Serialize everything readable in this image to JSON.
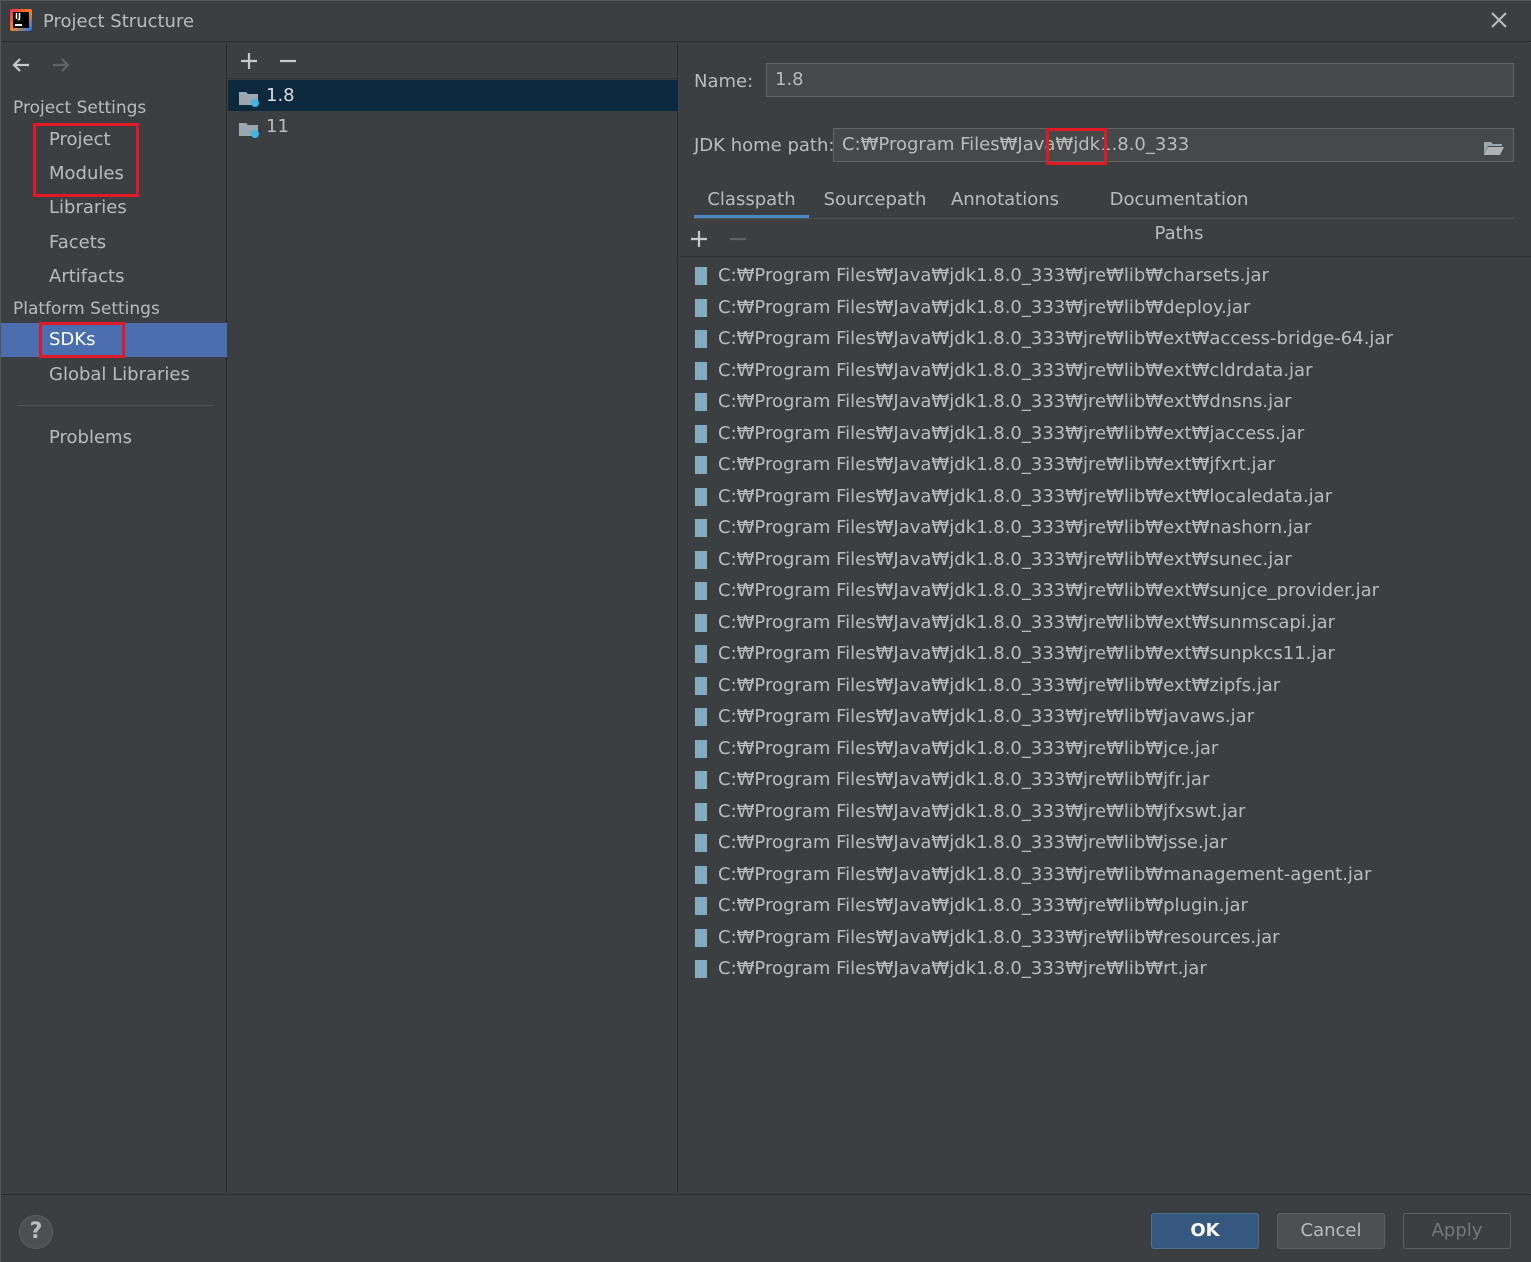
{
  "window": {
    "title": "Project Structure"
  },
  "sidebar": {
    "project_settings_title": "Project Settings",
    "project_items": [
      "Project",
      "Modules",
      "Libraries",
      "Facets",
      "Artifacts"
    ],
    "platform_settings_title": "Platform Settings",
    "platform_items": [
      "SDKs",
      "Global Libraries"
    ],
    "problems": "Problems",
    "selected": "SDKs"
  },
  "sdk_list": {
    "items": [
      "1.8",
      "11"
    ],
    "selected": "1.8"
  },
  "detail": {
    "name_label": "Name:",
    "name_value": "1.8",
    "jdk_home_label": "JDK home path:",
    "jdk_home_value": "C:₩Program Files₩Java₩jdk1.8.0_333",
    "tabs": [
      "Classpath",
      "Sourcepath",
      "Annotations",
      "Documentation Paths"
    ],
    "active_tab": "Classpath",
    "classpath": [
      "C:₩Program Files₩Java₩jdk1.8.0_333₩jre₩lib₩charsets.jar",
      "C:₩Program Files₩Java₩jdk1.8.0_333₩jre₩lib₩deploy.jar",
      "C:₩Program Files₩Java₩jdk1.8.0_333₩jre₩lib₩ext₩access-bridge-64.jar",
      "C:₩Program Files₩Java₩jdk1.8.0_333₩jre₩lib₩ext₩cldrdata.jar",
      "C:₩Program Files₩Java₩jdk1.8.0_333₩jre₩lib₩ext₩dnsns.jar",
      "C:₩Program Files₩Java₩jdk1.8.0_333₩jre₩lib₩ext₩jaccess.jar",
      "C:₩Program Files₩Java₩jdk1.8.0_333₩jre₩lib₩ext₩jfxrt.jar",
      "C:₩Program Files₩Java₩jdk1.8.0_333₩jre₩lib₩ext₩localedata.jar",
      "C:₩Program Files₩Java₩jdk1.8.0_333₩jre₩lib₩ext₩nashorn.jar",
      "C:₩Program Files₩Java₩jdk1.8.0_333₩jre₩lib₩ext₩sunec.jar",
      "C:₩Program Files₩Java₩jdk1.8.0_333₩jre₩lib₩ext₩sunjce_provider.jar",
      "C:₩Program Files₩Java₩jdk1.8.0_333₩jre₩lib₩ext₩sunmscapi.jar",
      "C:₩Program Files₩Java₩jdk1.8.0_333₩jre₩lib₩ext₩sunpkcs11.jar",
      "C:₩Program Files₩Java₩jdk1.8.0_333₩jre₩lib₩ext₩zipfs.jar",
      "C:₩Program Files₩Java₩jdk1.8.0_333₩jre₩lib₩javaws.jar",
      "C:₩Program Files₩Java₩jdk1.8.0_333₩jre₩lib₩jce.jar",
      "C:₩Program Files₩Java₩jdk1.8.0_333₩jre₩lib₩jfr.jar",
      "C:₩Program Files₩Java₩jdk1.8.0_333₩jre₩lib₩jfxswt.jar",
      "C:₩Program Files₩Java₩jdk1.8.0_333₩jre₩lib₩jsse.jar",
      "C:₩Program Files₩Java₩jdk1.8.0_333₩jre₩lib₩management-agent.jar",
      "C:₩Program Files₩Java₩jdk1.8.0_333₩jre₩lib₩plugin.jar",
      "C:₩Program Files₩Java₩jdk1.8.0_333₩jre₩lib₩resources.jar",
      "C:₩Program Files₩Java₩jdk1.8.0_333₩jre₩lib₩rt.jar"
    ]
  },
  "buttons": {
    "help": "?",
    "ok": "OK",
    "cancel": "Cancel",
    "apply": "Apply"
  },
  "colors": {
    "background": "#3c3f41",
    "selection": "#4b6eaf",
    "list_selection": "#0d293e",
    "highlight_box": "#e01a24",
    "ok_button": "#365880"
  }
}
